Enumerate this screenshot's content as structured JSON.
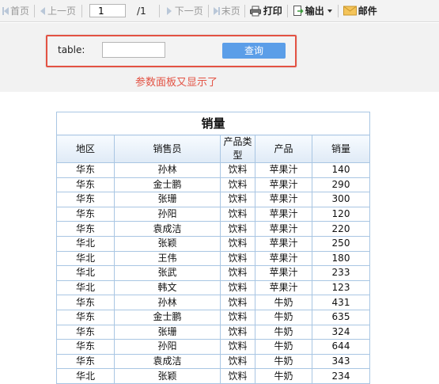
{
  "toolbar": {
    "first_label": "首页",
    "prev_label": "上一页",
    "page_value": "1",
    "page_total": "/1",
    "next_label": "下一页",
    "last_label": "末页",
    "print_label": "打印",
    "export_label": "输出",
    "mail_label": "邮件"
  },
  "param": {
    "label": "table:",
    "input_value": "",
    "query_label": "查询",
    "note": "参数面板又显示了"
  },
  "report": {
    "title": "销量",
    "headers": [
      "地区",
      "销售员",
      "产品类型",
      "产品",
      "销量"
    ],
    "rows": [
      [
        "华东",
        "孙林",
        "饮料",
        "苹果汁",
        "140"
      ],
      [
        "华东",
        "金士鹏",
        "饮料",
        "苹果汁",
        "290"
      ],
      [
        "华东",
        "张珊",
        "饮料",
        "苹果汁",
        "300"
      ],
      [
        "华东",
        "孙阳",
        "饮料",
        "苹果汁",
        "120"
      ],
      [
        "华东",
        "袁成洁",
        "饮料",
        "苹果汁",
        "220"
      ],
      [
        "华北",
        "张颖",
        "饮料",
        "苹果汁",
        "250"
      ],
      [
        "华北",
        "王伟",
        "饮料",
        "苹果汁",
        "180"
      ],
      [
        "华北",
        "张武",
        "饮料",
        "苹果汁",
        "233"
      ],
      [
        "华北",
        "韩文",
        "饮料",
        "苹果汁",
        "123"
      ],
      [
        "华东",
        "孙林",
        "饮料",
        "牛奶",
        "431"
      ],
      [
        "华东",
        "金士鹏",
        "饮料",
        "牛奶",
        "635"
      ],
      [
        "华东",
        "张珊",
        "饮料",
        "牛奶",
        "324"
      ],
      [
        "华东",
        "孙阳",
        "饮料",
        "牛奶",
        "644"
      ],
      [
        "华东",
        "袁成洁",
        "饮料",
        "牛奶",
        "343"
      ],
      [
        "华北",
        "张颖",
        "饮料",
        "牛奶",
        "234"
      ]
    ]
  },
  "colors": {
    "accent_button": "#5b9ee8",
    "highlight_border": "#e35243",
    "note_text": "#e35243",
    "table_border": "#a9c6e3"
  }
}
